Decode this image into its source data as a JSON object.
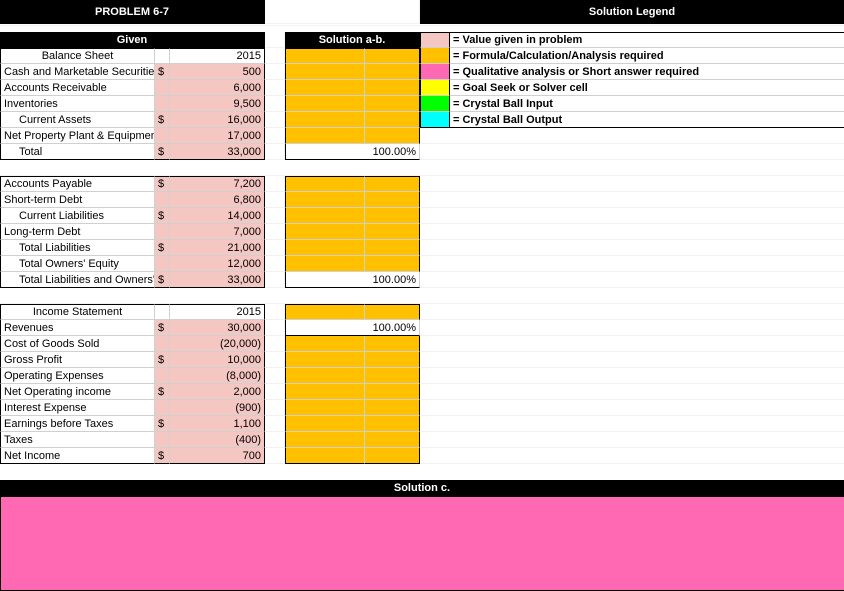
{
  "titles": {
    "problem": "PROBLEM 6-7",
    "legend": "Solution Legend",
    "given": "Given",
    "solutionAB": "Solution a-b.",
    "solutionC": "Solution c."
  },
  "legend": {
    "pink": "= Value given in problem",
    "gold": "= Formula/Calculation/Analysis required",
    "hotpink": "= Qualitative analysis or Short answer required",
    "yellow": "= Goal Seek or Solver cell",
    "green": "= Crystal Ball Input",
    "cyan": "= Crystal Ball Output"
  },
  "given": {
    "year": "2015",
    "bs": {
      "hdr": "Balance Sheet",
      "lines": {
        "cash": {
          "label": "Cash and Marketable Securities",
          "sym": "$",
          "val": "500"
        },
        "ar": {
          "label": "Accounts Receivable",
          "sym": "",
          "val": "6,000"
        },
        "inv": {
          "label": "Inventories",
          "sym": "",
          "val": "9,500"
        },
        "ca": {
          "label": "Current Assets",
          "sym": "$",
          "val": "16,000"
        },
        "ppe": {
          "label": "Net Property Plant & Equipment",
          "sym": "",
          "val": "17,000"
        },
        "total": {
          "label": "Total",
          "sym": "$",
          "val": "33,000"
        },
        "ap": {
          "label": "Accounts Payable",
          "sym": "$",
          "val": "7,200"
        },
        "std": {
          "label": "Short-term Debt",
          "sym": "",
          "val": "6,800"
        },
        "cl": {
          "label": "Current Liabilities",
          "sym": "$",
          "val": "14,000"
        },
        "ltd": {
          "label": "Long-term Debt",
          "sym": "",
          "val": "7,000"
        },
        "tl": {
          "label": "Total Liabilities",
          "sym": "$",
          "val": "21,000"
        },
        "toe": {
          "label": "Total Owners' Equity",
          "sym": "",
          "val": "12,000"
        },
        "tloe": {
          "label": "Total Liabilities and Owners' Equity",
          "sym": "$",
          "val": "33,000"
        }
      }
    },
    "is": {
      "hdr": "Income Statement",
      "year": "2015",
      "lines": {
        "rev": {
          "label": "Revenues",
          "sym": "$",
          "val": "30,000"
        },
        "cogs": {
          "label": "Cost of Goods Sold",
          "sym": "",
          "val": "(20,000)"
        },
        "gp": {
          "label": "Gross Profit",
          "sym": "$",
          "val": "10,000"
        },
        "oe": {
          "label": "Operating Expenses",
          "sym": "",
          "val": "(8,000)"
        },
        "noi": {
          "label": "Net Operating income",
          "sym": "$",
          "val": "2,000"
        },
        "ie": {
          "label": "Interest Expense",
          "sym": "",
          "val": "(900)"
        },
        "ebt": {
          "label": "Earnings before Taxes",
          "sym": "$",
          "val": "1,100"
        },
        "tax": {
          "label": "Taxes",
          "sym": "",
          "val": "(400)"
        },
        "ni": {
          "label": "Net Income",
          "sym": "$",
          "val": "700"
        }
      }
    }
  },
  "solutionAB": {
    "pct1": "100.00%",
    "pct2": "100.00%",
    "pct3": "100.00%"
  },
  "colors": {
    "pink": "#f4c7c3",
    "hotpink": "#ff69b4",
    "gold": "#ffc000",
    "yellow": "#ffff00",
    "green": "#00ff00",
    "cyan": "#00ffff"
  }
}
